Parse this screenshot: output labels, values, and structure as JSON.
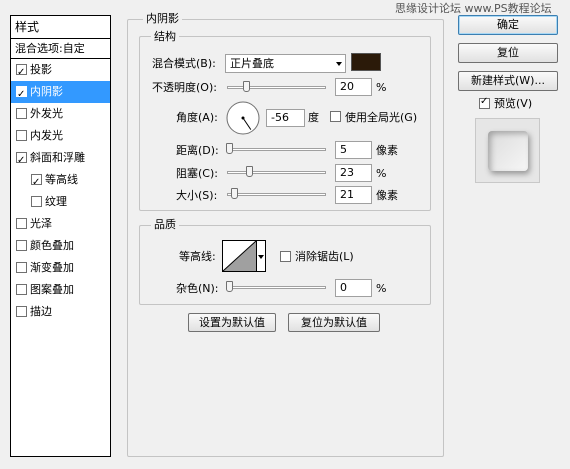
{
  "watermark": "思缘设计论坛 www.PS教程论坛",
  "styles_panel": {
    "header": "样式",
    "blend_options": "混合选项:自定",
    "items": [
      {
        "label": "投影",
        "checked": true,
        "selected": false,
        "indent": 0
      },
      {
        "label": "内阴影",
        "checked": true,
        "selected": true,
        "indent": 0
      },
      {
        "label": "外发光",
        "checked": false,
        "selected": false,
        "indent": 0
      },
      {
        "label": "内发光",
        "checked": false,
        "selected": false,
        "indent": 0
      },
      {
        "label": "斜面和浮雕",
        "checked": true,
        "selected": false,
        "indent": 0
      },
      {
        "label": "等高线",
        "checked": true,
        "selected": false,
        "indent": 1
      },
      {
        "label": "纹理",
        "checked": false,
        "selected": false,
        "indent": 1
      },
      {
        "label": "光泽",
        "checked": false,
        "selected": false,
        "indent": 0
      },
      {
        "label": "颜色叠加",
        "checked": false,
        "selected": false,
        "indent": 0
      },
      {
        "label": "渐变叠加",
        "checked": false,
        "selected": false,
        "indent": 0
      },
      {
        "label": "图案叠加",
        "checked": false,
        "selected": false,
        "indent": 0
      },
      {
        "label": "描边",
        "checked": false,
        "selected": false,
        "indent": 0
      }
    ]
  },
  "inner_shadow": {
    "title": "内阴影",
    "structure": {
      "title": "结构",
      "blend_mode_label": "混合模式(B):",
      "blend_mode_value": "正片叠底",
      "color": "#2b1a09",
      "opacity_label": "不透明度(O):",
      "opacity_value": "20",
      "opacity_unit": "%",
      "opacity_fraction": 0.2,
      "angle_label": "角度(A):",
      "angle_value": "-56",
      "angle_unit": "度",
      "global_light_label": "使用全局光(G)",
      "global_light_checked": false,
      "distance_label": "距离(D):",
      "distance_value": "5",
      "distance_unit": "像素",
      "distance_fraction": 0.02,
      "choke_label": "阻塞(C):",
      "choke_value": "23",
      "choke_unit": "%",
      "choke_fraction": 0.23,
      "size_label": "大小(S):",
      "size_value": "21",
      "size_unit": "像素",
      "size_fraction": 0.08
    },
    "quality": {
      "title": "品质",
      "contour_label": "等高线:",
      "anti_alias_label": "消除锯齿(L)",
      "anti_alias_checked": false,
      "noise_label": "杂色(N):",
      "noise_value": "0",
      "noise_unit": "%",
      "noise_fraction": 0.0
    },
    "set_default_label": "设置为默认值",
    "reset_default_label": "复位为默认值"
  },
  "right_panel": {
    "ok_label": "确定",
    "reset_label": "复位",
    "new_style_label": "新建样式(W)...",
    "preview_label": "预览(V)",
    "preview_checked": true
  }
}
